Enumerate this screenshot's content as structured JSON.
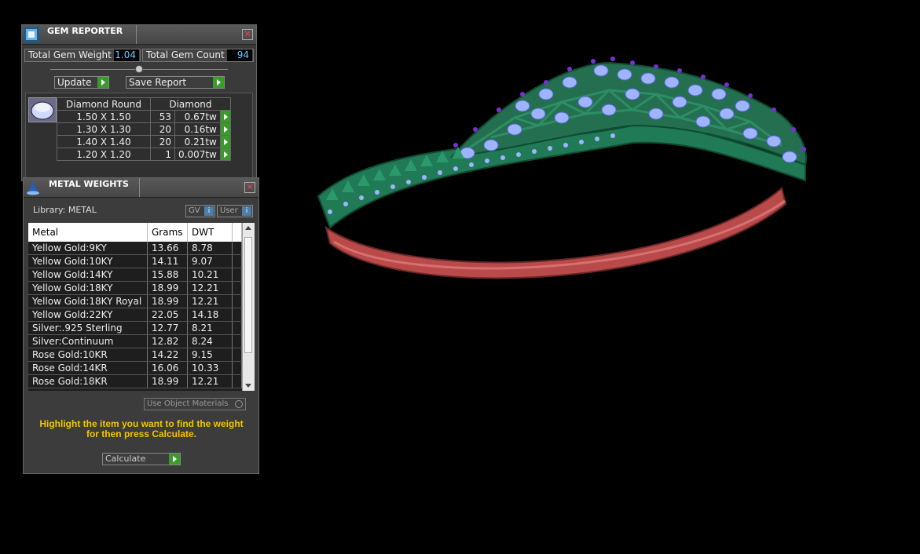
{
  "gem_reporter": {
    "title": "GEM REPORTER",
    "total_weight_label": "Total Gem Weight",
    "total_weight_value": "1.04",
    "total_count_label": "Total Gem Count",
    "total_count_value": "94",
    "update_label": "Update",
    "save_label": "Save Report",
    "gem_headers": [
      "Diamond Round",
      "Diamond"
    ],
    "gems": [
      {
        "size": "1.50 X 1.50",
        "count": "53",
        "weight": "0.67tw"
      },
      {
        "size": "1.30 X 1.30",
        "count": "20",
        "weight": "0.16tw"
      },
      {
        "size": "1.40 X 1.40",
        "count": "20",
        "weight": "0.21tw"
      },
      {
        "size": "1.20 X 1.20",
        "count": "1",
        "weight": "0.007tw"
      }
    ]
  },
  "metal_weights": {
    "title": "METAL WEIGHTS",
    "library_label": "Library: METAL",
    "gv_label": "GV",
    "user_label": "User",
    "headers": [
      "Metal",
      "Grams",
      "DWT"
    ],
    "rows": [
      {
        "metal": "Yellow Gold:9KY",
        "grams": "13.66",
        "dwt": "8.78"
      },
      {
        "metal": "Yellow Gold:10KY",
        "grams": "14.11",
        "dwt": "9.07"
      },
      {
        "metal": "Yellow Gold:14KY",
        "grams": "15.88",
        "dwt": "10.21"
      },
      {
        "metal": "Yellow Gold:18KY",
        "grams": "18.99",
        "dwt": "12.21"
      },
      {
        "metal": "Yellow Gold:18KY Royal",
        "grams": "18.99",
        "dwt": "12.21"
      },
      {
        "metal": "Yellow Gold:22KY",
        "grams": "22.05",
        "dwt": "14.18"
      },
      {
        "metal": "Silver:.925 Sterling",
        "grams": "12.77",
        "dwt": "8.21"
      },
      {
        "metal": "Silver:Continuum",
        "grams": "12.82",
        "dwt": "8.24"
      },
      {
        "metal": "Rose Gold:10KR",
        "grams": "14.22",
        "dwt": "9.15"
      },
      {
        "metal": "Rose Gold:14KR",
        "grams": "16.06",
        "dwt": "10.33"
      },
      {
        "metal": "Rose Gold:18KR",
        "grams": "18.99",
        "dwt": "12.21"
      }
    ],
    "use_object_materials_label": "Use Object Materials",
    "hint_line1": "Highlight the item you want to find the weight",
    "hint_line2": "for then press Calculate.",
    "calculate_label": "Calculate"
  },
  "colors": {
    "panel_bg": "#3a3a3a",
    "value_text": "#66ccff",
    "hint_text": "#f5c400",
    "go_button": "#3a9a2a",
    "band_green": "#1f7a55",
    "band_red": "#b84a4a",
    "gem_blue": "#9fb4ff",
    "gem_purple": "#7a2fd0"
  }
}
